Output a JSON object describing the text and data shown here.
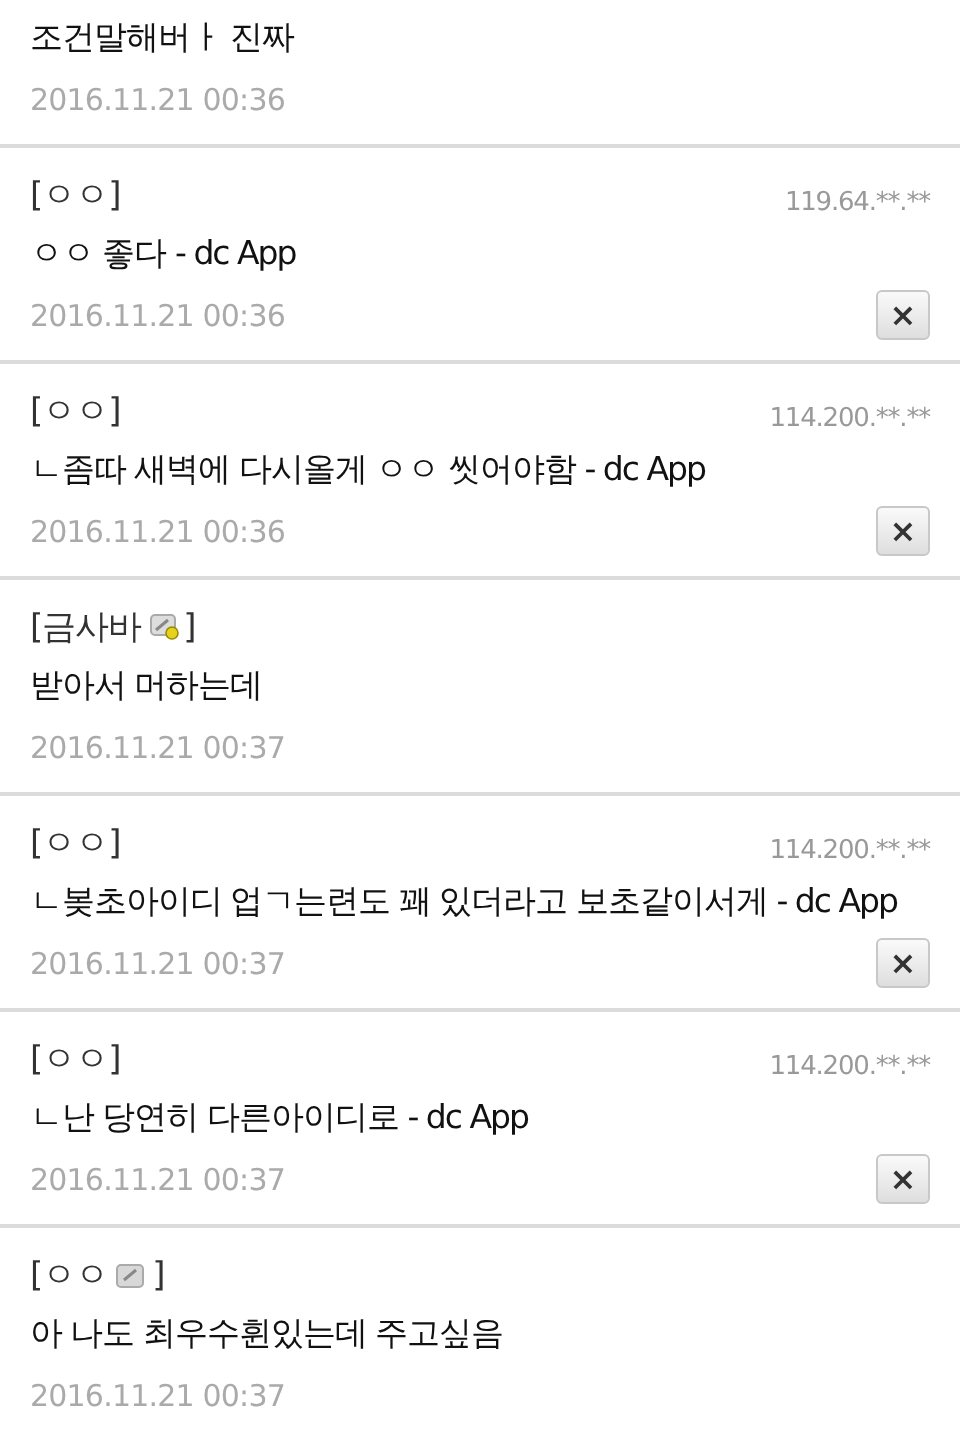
{
  "brackets": [
    "[",
    "]"
  ],
  "comments": [
    {
      "kind": "plain",
      "text": "조건말해버ㅏ 진짜",
      "date": "2016.11.21 00:36"
    },
    {
      "kind": "guest",
      "author": "ㅇㅇ",
      "ip": "119.64.**.**",
      "text": "ㅇㅇ 좋다 - dc App",
      "date": "2016.11.21 00:36",
      "delete": "×"
    },
    {
      "kind": "guest",
      "author": "ㅇㅇ",
      "ip": "114.200.**.**",
      "text": "ㄴ좀따 새벽에 다시올게 ㅇㅇ 씻어야함 - dc App",
      "date": "2016.11.21 00:36",
      "delete": "×"
    },
    {
      "kind": "fixed",
      "author": "금사바",
      "text": "받아서 머하는데",
      "date": "2016.11.21 00:37"
    },
    {
      "kind": "guest",
      "author": "ㅇㅇ",
      "ip": "114.200.**.**",
      "text": "ㄴ봊초아이디 업ㄱ는련도 꽤 있더라고 보초같이서게 - dc App",
      "date": "2016.11.21 00:37",
      "delete": "×"
    },
    {
      "kind": "guest",
      "author": "ㅇㅇ",
      "ip": "114.200.**.**",
      "text": "ㄴ난 당연히 다른아이디로 - dc App",
      "date": "2016.11.21 00:37",
      "delete": "×"
    },
    {
      "kind": "flowing",
      "author": "ㅇㅇ",
      "text": "아 나도 최우수휜있는데 주고싶음",
      "date": "2016.11.21 00:37"
    }
  ]
}
